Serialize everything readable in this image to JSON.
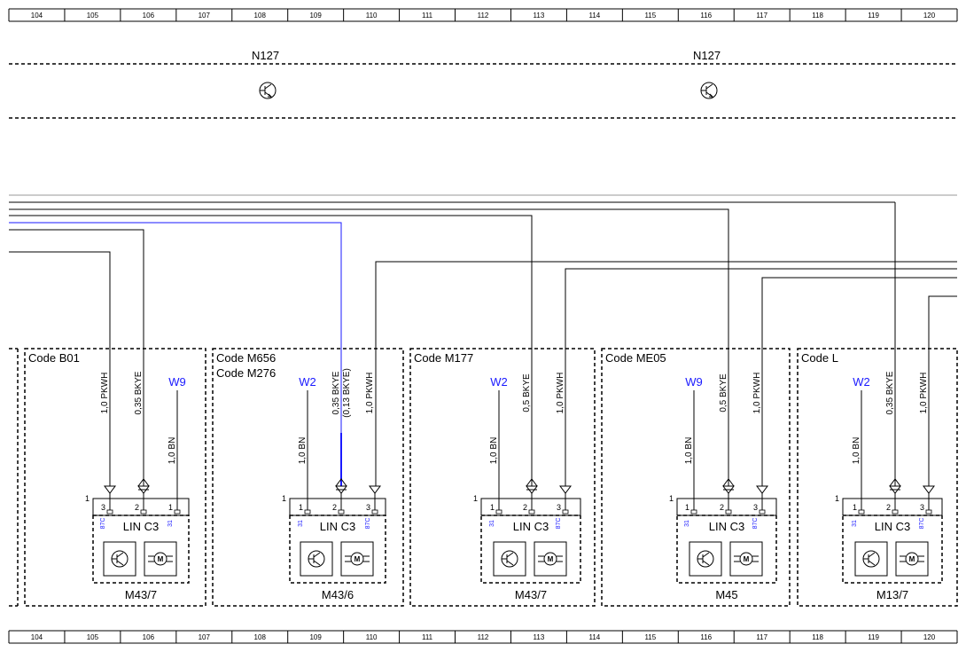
{
  "ruler": [
    "104",
    "105",
    "106",
    "107",
    "108",
    "109",
    "110",
    "111",
    "112",
    "113",
    "114",
    "115",
    "116",
    "117",
    "118",
    "119",
    "120"
  ],
  "colors": {
    "blue": "#1a1aff",
    "black": "#000000",
    "grey": "#999999"
  },
  "top_components": [
    {
      "label": "N127",
      "icon": "transistor-icon"
    },
    {
      "label": "N127",
      "icon": "transistor-icon"
    }
  ],
  "modules": [
    {
      "codes": [
        "Code B01"
      ],
      "label": "M43/7",
      "lin": "LIN C3",
      "ground": "W9",
      "pins": [
        {
          "num": "3",
          "alt": "87C",
          "wire": "1,0 PKWH"
        },
        {
          "num": "2",
          "alt": "",
          "wire": "0,35 BKYE"
        },
        {
          "num": "1",
          "alt": "31",
          "wire": "1,0 BN"
        }
      ]
    },
    {
      "codes": [
        "Code M656",
        "Code M276"
      ],
      "label": "M43/6",
      "lin": "LIN C3",
      "ground": "W2",
      "pins": [
        {
          "num": "1",
          "alt": "31",
          "wire": "1,0 BN"
        },
        {
          "num": "2",
          "alt": "",
          "wire": "0,35 BKYE",
          "wire2": "(0,13 BKYE)"
        },
        {
          "num": "3",
          "alt": "87C",
          "wire": "1,0 PKWH"
        }
      ]
    },
    {
      "codes": [
        "Code M177"
      ],
      "label": "M43/7",
      "lin": "LIN C3",
      "ground": "W2",
      "pins": [
        {
          "num": "1",
          "alt": "31",
          "wire": "1,0 BN"
        },
        {
          "num": "2",
          "alt": "",
          "wire": "0,5 BKYE"
        },
        {
          "num": "3",
          "alt": "87C",
          "wire": "1,0 PKWH"
        }
      ]
    },
    {
      "codes": [
        "Code ME05"
      ],
      "label": "M45",
      "lin": "LIN C3",
      "ground": "W9",
      "pins": [
        {
          "num": "1",
          "alt": "31",
          "wire": "1,0 BN"
        },
        {
          "num": "2",
          "alt": "",
          "wire": "0,5 BKYE"
        },
        {
          "num": "3",
          "alt": "87C",
          "wire": "1,0 PKWH"
        }
      ]
    },
    {
      "codes": [
        "Code L"
      ],
      "label": "M13/7",
      "lin": "LIN C3",
      "ground": "W2",
      "pins": [
        {
          "num": "1",
          "alt": "31",
          "wire": "1,0 BN"
        },
        {
          "num": "2",
          "alt": "",
          "wire": "0,35 BKYE"
        },
        {
          "num": "3",
          "alt": "87C",
          "wire": "1,0 PKWH"
        }
      ]
    }
  ],
  "connector_index": "1"
}
